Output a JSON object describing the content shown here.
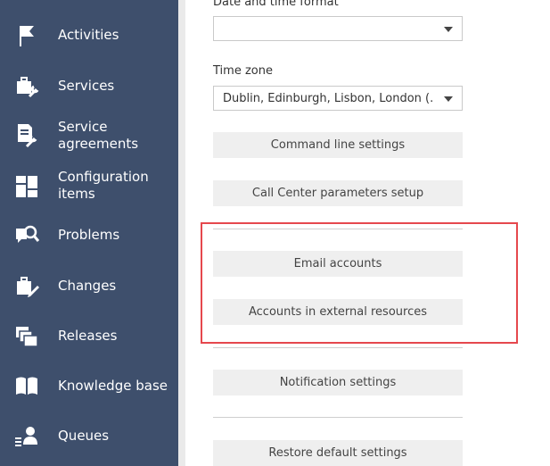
{
  "sidebar": {
    "items": [
      {
        "label": "Activities",
        "icon": "flag-icon"
      },
      {
        "label": "Services",
        "icon": "services-icon"
      },
      {
        "label_line1": "Service",
        "label_line2": "agreements",
        "icon": "service-agreements-icon"
      },
      {
        "label_line1": "Configuration",
        "label_line2": "items",
        "icon": "configuration-items-icon"
      },
      {
        "label": "Problems",
        "icon": "problems-icon"
      },
      {
        "label": "Changes",
        "icon": "changes-icon"
      },
      {
        "label": "Releases",
        "icon": "releases-icon"
      },
      {
        "label": "Knowledge base",
        "icon": "book-icon"
      },
      {
        "label": "Queues",
        "icon": "queues-icon"
      }
    ],
    "colors": {
      "background": "#3e4f6c",
      "text": "#ffffff"
    }
  },
  "main": {
    "date_time_format": {
      "label": "Date and time format",
      "value": ""
    },
    "time_zone": {
      "label": "Time zone",
      "value": "Dublin, Edinburgh, Lisbon, London (..."
    },
    "buttons": {
      "command_line": "Command line settings",
      "call_center": "Call Center parameters setup",
      "email_accounts": "Email accounts",
      "external_accounts": "Accounts in external resources",
      "notifications": "Notification settings",
      "restore_defaults": "Restore default settings"
    },
    "colors": {
      "highlight": "#e5484d",
      "button_bg": "#efefef"
    }
  }
}
